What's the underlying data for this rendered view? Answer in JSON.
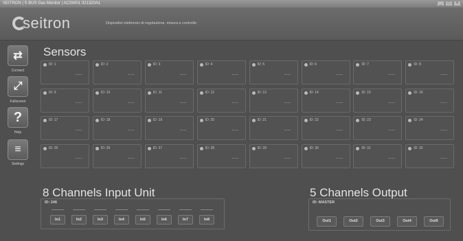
{
  "window": {
    "title": "SEITRON | S BUS Gas Monitor | ACSW01 021320A1",
    "buttons": [
      "_",
      "□",
      "×"
    ]
  },
  "header": {
    "brand": "seitron",
    "tagline": "Dispositivi elettronici di regolazione, misura e controllo"
  },
  "sidebar": {
    "items": [
      {
        "label": "Connect",
        "icon": "connect-arrows-icon",
        "glyph": "⇄"
      },
      {
        "label": "Fullscreen",
        "icon": "fullscreen-icon",
        "glyph": "⤢"
      },
      {
        "label": "Help",
        "icon": "help-icon",
        "glyph": "?"
      },
      {
        "label": "Settings",
        "icon": "settings-sliders-icon",
        "glyph": "≡"
      }
    ]
  },
  "sensors": {
    "title": "Sensors",
    "empty_value": "----",
    "ids": [
      "ID: 1",
      "ID: 2",
      "ID: 3",
      "ID: 4",
      "ID: 5",
      "ID: 6",
      "ID: 7",
      "ID: 8",
      "ID: 9",
      "ID: 10",
      "ID: 11",
      "ID: 12",
      "ID: 13",
      "ID: 14",
      "ID: 15",
      "ID: 16",
      "ID: 17",
      "ID: 18",
      "ID: 19",
      "ID: 20",
      "ID: 21",
      "ID: 22",
      "ID: 23",
      "ID: 24",
      "ID: 25",
      "ID: 26",
      "ID: 27",
      "ID: 28",
      "ID: 29",
      "ID: 30",
      "ID: 31",
      "ID: 32"
    ]
  },
  "input_unit": {
    "title": "8 Channels Input Unit",
    "id_label": "ID: 246",
    "channels": [
      "In1",
      "In2",
      "In3",
      "In4",
      "In5",
      "In6",
      "In7",
      "In8"
    ]
  },
  "output_unit": {
    "title": "5 Channels Output",
    "id_label": "ID: MASTER",
    "channels": [
      "Out1",
      "Out2",
      "Out3",
      "Out4",
      "Out5"
    ]
  }
}
